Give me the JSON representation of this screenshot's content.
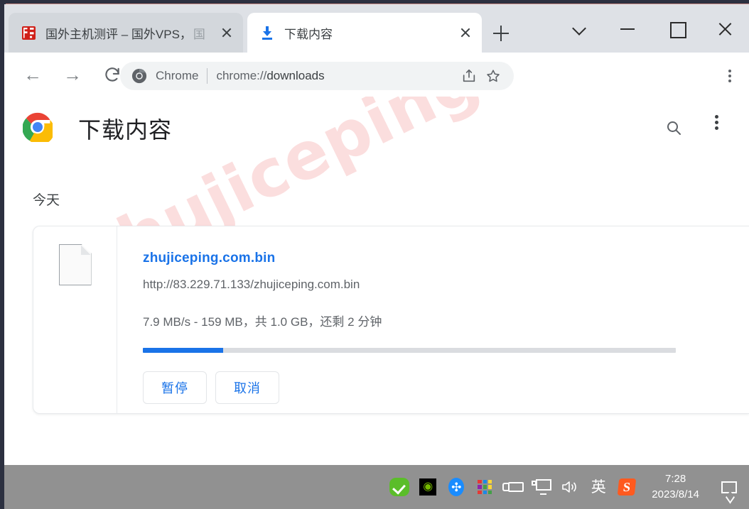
{
  "window": {
    "controls": {
      "tab_search": "chevron-down",
      "minimize": "minimize",
      "maximize": "maximize",
      "close": "close"
    }
  },
  "tabs": [
    {
      "title": "国外主机测评 – 国外VPS，",
      "truncation_glyph": "国",
      "favicon": "red-site-icon",
      "active": false,
      "close_label": "×"
    },
    {
      "title": "下载内容",
      "favicon": "download-icon",
      "active": true,
      "close_label": "×"
    }
  ],
  "new_tab": {
    "label": "+"
  },
  "toolbar": {
    "back": "←",
    "forward": "→",
    "reload": "reload-icon",
    "omnibox": {
      "site_label": "Chrome",
      "url_scheme": "chrome://",
      "url_path": "downloads",
      "url_full": "chrome://downloads",
      "share_icon": "share-icon",
      "bookmark_icon": "star-icon"
    },
    "menu": "three-dot-menu"
  },
  "page": {
    "logo": "chrome-logo",
    "title": "下载内容",
    "search_icon": "search-icon",
    "menu_icon": "three-dot-menu",
    "watermark": "zhujiceping.com",
    "section_label": "今天",
    "download": {
      "file_icon": "generic-file-icon",
      "filename": "zhujiceping.com.bin",
      "url": "http://83.229.71.133/zhujiceping.com.bin",
      "status": "7.9 MB/s - 159 MB，共 1.0 GB，还剩 2 分钟",
      "progress_percent": 15,
      "pause_label": "暂停",
      "cancel_label": "取消"
    }
  },
  "taskbar": {
    "tray": [
      {
        "name": "security-check-icon",
        "glyph": "✔"
      },
      {
        "name": "nvidia-icon",
        "glyph": "◉"
      },
      {
        "name": "bluetooth-icon",
        "glyph": "✜"
      },
      {
        "name": "color-grid-icon",
        "glyph": "▦"
      },
      {
        "name": "battery-charging-icon",
        "glyph": "▭"
      },
      {
        "name": "display-icon",
        "glyph": "🖵"
      },
      {
        "name": "volume-icon",
        "glyph": "🔊"
      },
      {
        "name": "ime-icon",
        "glyph": "英"
      },
      {
        "name": "sogou-icon",
        "glyph": "S"
      }
    ],
    "clock": {
      "time": "7:28",
      "date": "2023/8/14"
    },
    "notification_icon": "notification-icon"
  },
  "colors": {
    "accent_blue": "#1a73e8",
    "tabstrip_bg": "#dee1e6",
    "taskbar_bg": "#919191",
    "watermark_pink": "#fbdede"
  }
}
